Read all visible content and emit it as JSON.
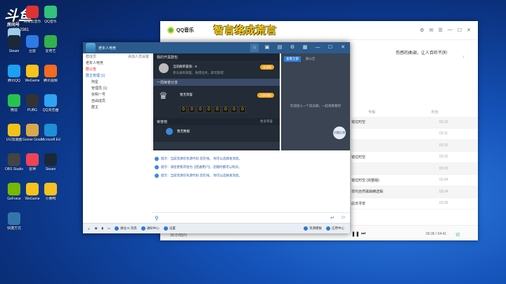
{
  "watermark": {
    "brand": "斗鱼",
    "sub": "房间号",
    "room": "9012981"
  },
  "desktop_icons": [
    {
      "label": "回收站",
      "color": "#9ecbe8"
    },
    {
      "label": "网易云音乐",
      "color": "#d33"
    },
    {
      "label": "QQ音乐",
      "color": "#31c27c"
    },
    {
      "label": "Steam",
      "color": "#1b2838"
    },
    {
      "label": "迅雷",
      "color": "#2f7ae5"
    },
    {
      "label": "爱奇艺",
      "color": "#33b14a"
    },
    {
      "label": "腾讯QQ",
      "color": "#1ea0f0"
    },
    {
      "label": "WeGame",
      "color": "#f7c21a"
    },
    {
      "label": "腾讯视频",
      "color": "#f56a1e"
    },
    {
      "label": "微信",
      "color": "#27c34c"
    },
    {
      "label": "PUBG",
      "color": "#333"
    },
    {
      "label": "QQ浏览器",
      "color": "#2fa4f0"
    },
    {
      "label": "UU加速器",
      "color": "#f2c21a"
    },
    {
      "label": "Goose Goose Duck",
      "color": "#d9a84a"
    },
    {
      "label": "Microsoft Edge",
      "color": "#1f8fd6"
    },
    {
      "label": "OBS Studio",
      "color": "#444"
    },
    {
      "label": "雷神",
      "color": "#e45"
    },
    {
      "label": "Steam",
      "color": "#1b2838"
    },
    {
      "label": "GeForce",
      "color": "#76b900"
    },
    {
      "label": "WeGame",
      "color": "#f7c21a"
    },
    {
      "label": "小黄鸭",
      "color": "#f5c020"
    },
    {
      "label": "快捷方式",
      "color": "#37a"
    }
  ],
  "music": {
    "app_name": "QQ音乐",
    "overlay_title": "智言络成荒言",
    "lyric_snippet": "伤感的曲调，让人百听不厌!",
    "header_cols": [
      "专辑",
      "时长"
    ],
    "rows": [
      {
        "album": "错位时空",
        "song": "",
        "time": "03:23"
      },
      {
        "album": "",
        "song": "",
        "time": "03:11"
      },
      {
        "album": "",
        "song": "",
        "time": "03:31"
      },
      {
        "album": "错位时空",
        "song": "",
        "time": "03:22"
      },
      {
        "album": "",
        "song": "",
        "time": "03:23"
      },
      {
        "album": "错位时空 (完整版)",
        "song": "",
        "time": "03:24"
      },
      {
        "album": "现代自然歌曲精选辑",
        "song": "",
        "time": "03:24"
      },
      {
        "album": "此日寻安",
        "song": "",
        "time": "03:29"
      }
    ],
    "player_time": "00:35 / 04:41",
    "lyric_btn": "词",
    "bottom_text": "张杰唱的"
  },
  "chat": {
    "title": "老年人电竞",
    "tabs": [
      "群聊",
      "公告",
      "相册",
      "文件",
      "设置"
    ],
    "left_header": "群成员",
    "left_sub": "添加人员设置",
    "groups": [
      {
        "label": "老年人电竞",
        "style": ""
      },
      {
        "label": "群公告",
        "style": "red"
      },
      {
        "label": "群主管理 (1)",
        "style": "blue"
      },
      {
        "label": "阿星",
        "style": ""
      },
      {
        "label": "管理员 (1)",
        "style": ""
      },
      {
        "label": "张明一号",
        "style": ""
      },
      {
        "label": "自由成员",
        "style": ""
      },
      {
        "label": "群主",
        "style": ""
      }
    ],
    "banner": {
      "section1": "我的开黑鼓包",
      "line1": "当前群荣誉值：0",
      "line1b": "参与发布荣誉，免得任务，即可获得",
      "section2": "一周荣誉分享",
      "line2": "暂无荣誉",
      "section3": "荣誉榜",
      "line3": "暂无数据",
      "btn1": "去领取",
      "btn2": "立即领取",
      "btn3": "更多荣誉",
      "digits": [
        "0",
        "0",
        "0",
        "0",
        "0",
        "0",
        "0",
        "0"
      ]
    },
    "side_panel": {
      "tab1": "查看全部",
      "tab2": "群公告",
      "msg": "欢迎加入一个成员群，一起来看看吧",
      "badge": "问题反馈"
    },
    "messages": [
      "提示：当前资源仅有源代码 您在线。 你可以选择发消息。",
      "提示：请您更新开放为【普通用户】，您随时都可以购买。",
      "提示：当前资源仅有源代码 您在线。 你可以选择发消息。"
    ],
    "bottom": {
      "b1": "群主AI 消息",
      "b2": "通知中心",
      "b3": "设置",
      "b4": "资源模板",
      "b5": "应用中心"
    }
  }
}
